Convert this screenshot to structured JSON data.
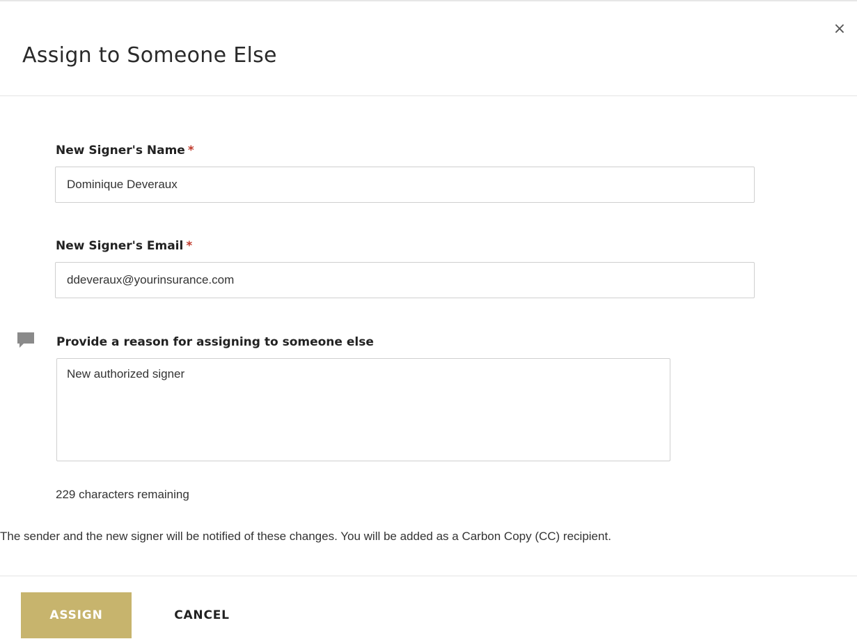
{
  "dialog": {
    "title": "Assign to Someone Else",
    "close_glyph": "×",
    "close_icon": "close-icon"
  },
  "form": {
    "name_label": "New Signer's Name",
    "name_value": "Dominique Deveraux",
    "email_label": "New Signer's Email",
    "email_value": "ddeveraux@yourinsurance.com",
    "required_mark": "*",
    "reason_label": "Provide a reason for assigning to someone else",
    "reason_value": "New authorized signer",
    "reason_icon": "comment-icon",
    "counter_text": "229 characters remaining"
  },
  "notice": "The sender and the new signer will be notified of these changes. You will be added as a Carbon Copy (CC) recipient.",
  "buttons": {
    "assign_label": "ASSIGN",
    "cancel_label": "CANCEL"
  },
  "colors": {
    "accent": "#c7b46d",
    "required": "#c0392b",
    "icon_gray": "#8a8a8a"
  }
}
